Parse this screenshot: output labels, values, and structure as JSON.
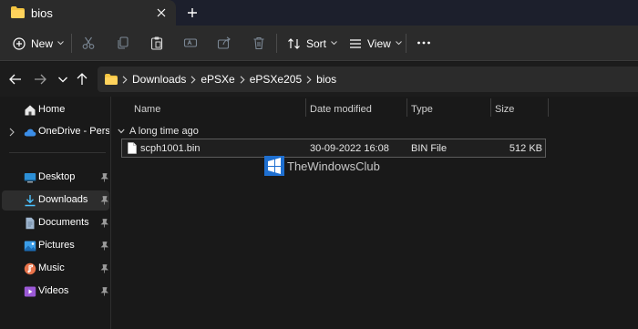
{
  "tab": {
    "title": "bios"
  },
  "toolbar": {
    "new_label": "New",
    "sort_label": "Sort",
    "view_label": "View"
  },
  "address": {
    "crumbs": [
      "Downloads",
      "ePSXe",
      "ePSXe205",
      "bios"
    ]
  },
  "sidebar": {
    "items": [
      {
        "label": "Home",
        "icon": "home-icon"
      },
      {
        "label": "OneDrive - Persona",
        "icon": "cloud-icon"
      },
      {
        "label": "Desktop",
        "icon": "desktop-icon",
        "pinned": true
      },
      {
        "label": "Downloads",
        "icon": "download-icon",
        "pinned": true,
        "selected": true
      },
      {
        "label": "Documents",
        "icon": "documents-icon",
        "pinned": true
      },
      {
        "label": "Pictures",
        "icon": "pictures-icon",
        "pinned": true
      },
      {
        "label": "Music",
        "icon": "music-icon",
        "pinned": true
      },
      {
        "label": "Videos",
        "icon": "videos-icon",
        "pinned": true
      }
    ]
  },
  "columns": [
    "Name",
    "Date modified",
    "Type",
    "Size"
  ],
  "group": {
    "label": "A long time ago"
  },
  "files": [
    {
      "name": "scph1001.bin",
      "date_modified": "30-09-2022 16:08",
      "type": "BIN File",
      "size": "512 KB"
    }
  ],
  "watermark": {
    "text": "TheWindowsClub"
  },
  "colors": {
    "tabstrip": "#1c1f2c",
    "toolbar": "#2b2b2b",
    "background": "#191919",
    "folder": "#f4c542",
    "onedrive": "#3b8ee8",
    "downloads": "#4cc2ff"
  }
}
